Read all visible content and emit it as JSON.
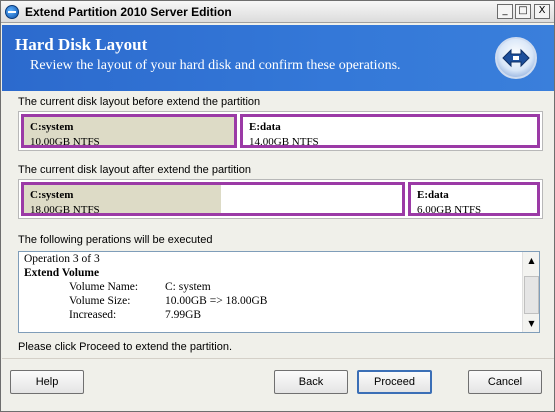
{
  "window": {
    "title": "Extend Partition 2010 Server Edition",
    "controls": {
      "minimize": "_",
      "maximize": "□",
      "close": "X"
    }
  },
  "header": {
    "title": "Hard Disk Layout",
    "subtitle": "Review the layout of your hard disk and confirm these operations."
  },
  "before": {
    "label": "The current disk layout before extend the partition",
    "partitions": [
      {
        "name": "C:system",
        "size": "10.00GB NTFS",
        "used_fraction": 1.0
      },
      {
        "name": "E:data",
        "size": "14.00GB NTFS",
        "used_fraction": 0.0
      }
    ]
  },
  "after": {
    "label": "The current disk layout after extend the partition",
    "partitions": [
      {
        "name": "C:system",
        "size": "18.00GB NTFS",
        "used_fraction": 0.52
      },
      {
        "name": "E:data",
        "size": "6.00GB NTFS",
        "used_fraction": 0.0
      }
    ]
  },
  "operations": {
    "label": "The following perations will be executed",
    "counter": "Operation 3 of 3",
    "heading": "Extend Volume",
    "rows": [
      {
        "key": "Volume Name:",
        "value": "C: system"
      },
      {
        "key": "Volume Size:",
        "value": "10.00GB => 18.00GB"
      },
      {
        "key": "Increased:",
        "value": "7.99GB"
      }
    ]
  },
  "footer_text": "Please click Proceed to extend the partition.",
  "buttons": {
    "help": "Help",
    "back": "Back",
    "proceed": "Proceed",
    "cancel": "Cancel"
  },
  "colors": {
    "banner": "#3478d8",
    "partition_border": "#9b3aa6",
    "used_fill": "#dddbc6"
  }
}
